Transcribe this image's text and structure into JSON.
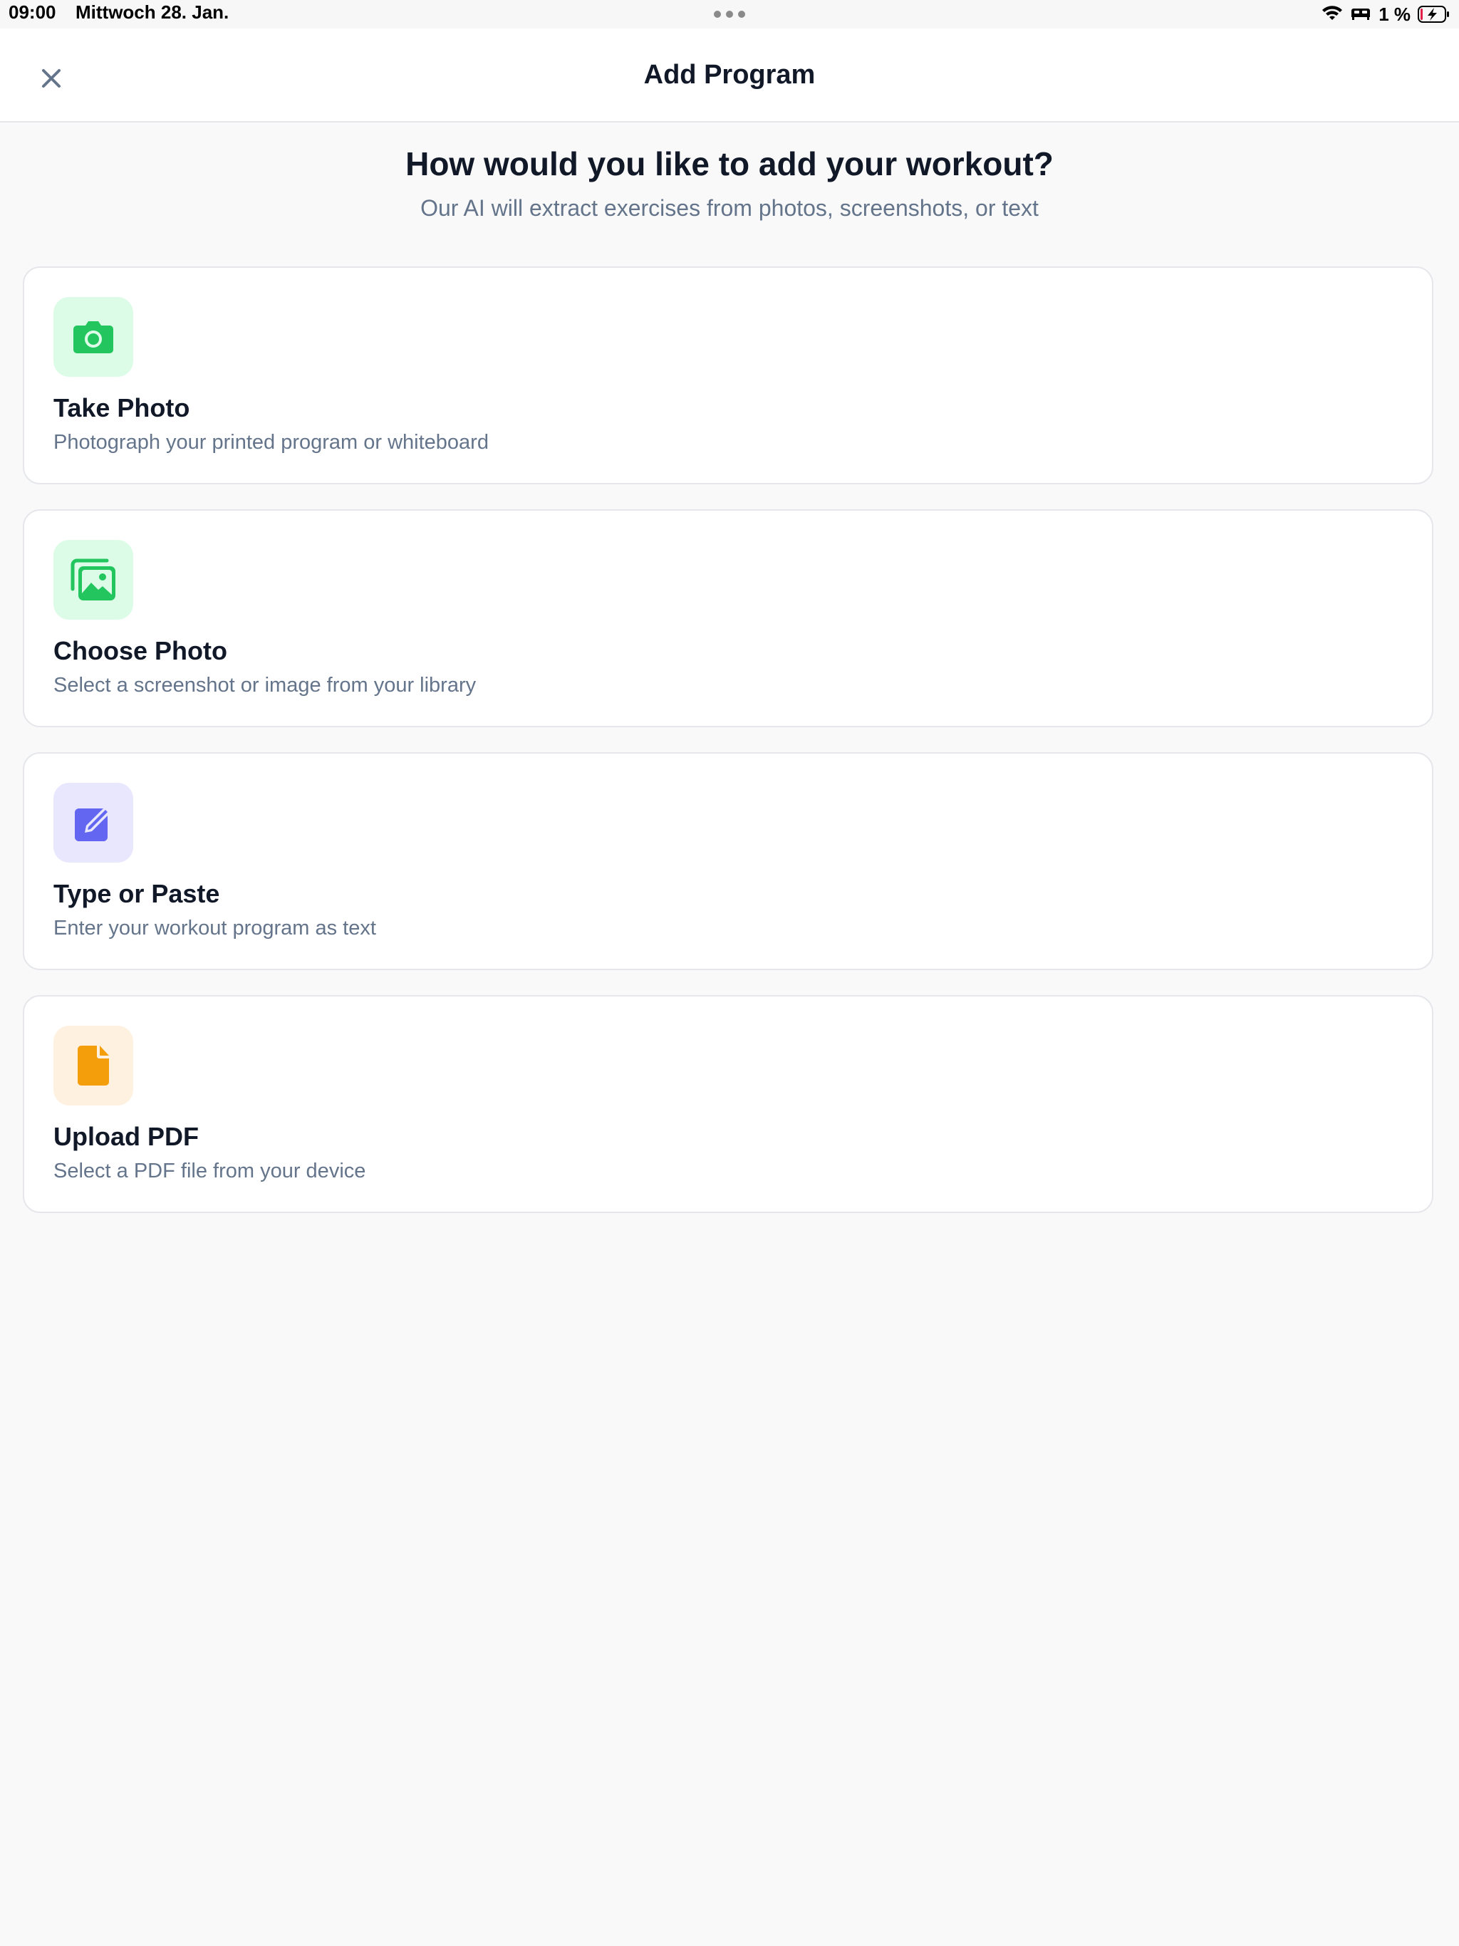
{
  "status_bar": {
    "time": "09:00",
    "date": "Mittwoch 28. Jan.",
    "battery": "1 %"
  },
  "header": {
    "title": "Add Program",
    "close_icon": "close-icon"
  },
  "intro": {
    "title": "How would you like to add your workout?",
    "subtitle": "Our AI will extract exercises from photos, screenshots, or text"
  },
  "options": [
    {
      "title": "Take Photo",
      "description": "Photograph your printed program or whiteboard",
      "icon": "camera-icon",
      "accent": "#22c55e",
      "icon_bg": "#dcfce7"
    },
    {
      "title": "Choose Photo",
      "description": "Select a screenshot or image from your library",
      "icon": "photo-library-icon",
      "accent": "#22c55e",
      "icon_bg": "#dcfce7"
    },
    {
      "title": "Type or Paste",
      "description": "Enter your workout program as text",
      "icon": "edit-icon",
      "accent": "#6366f1",
      "icon_bg": "#e8e7fd"
    },
    {
      "title": "Upload PDF",
      "description": "Select a PDF file from your device",
      "icon": "document-icon",
      "accent": "#f59e0b",
      "icon_bg": "#fef1e0"
    }
  ]
}
